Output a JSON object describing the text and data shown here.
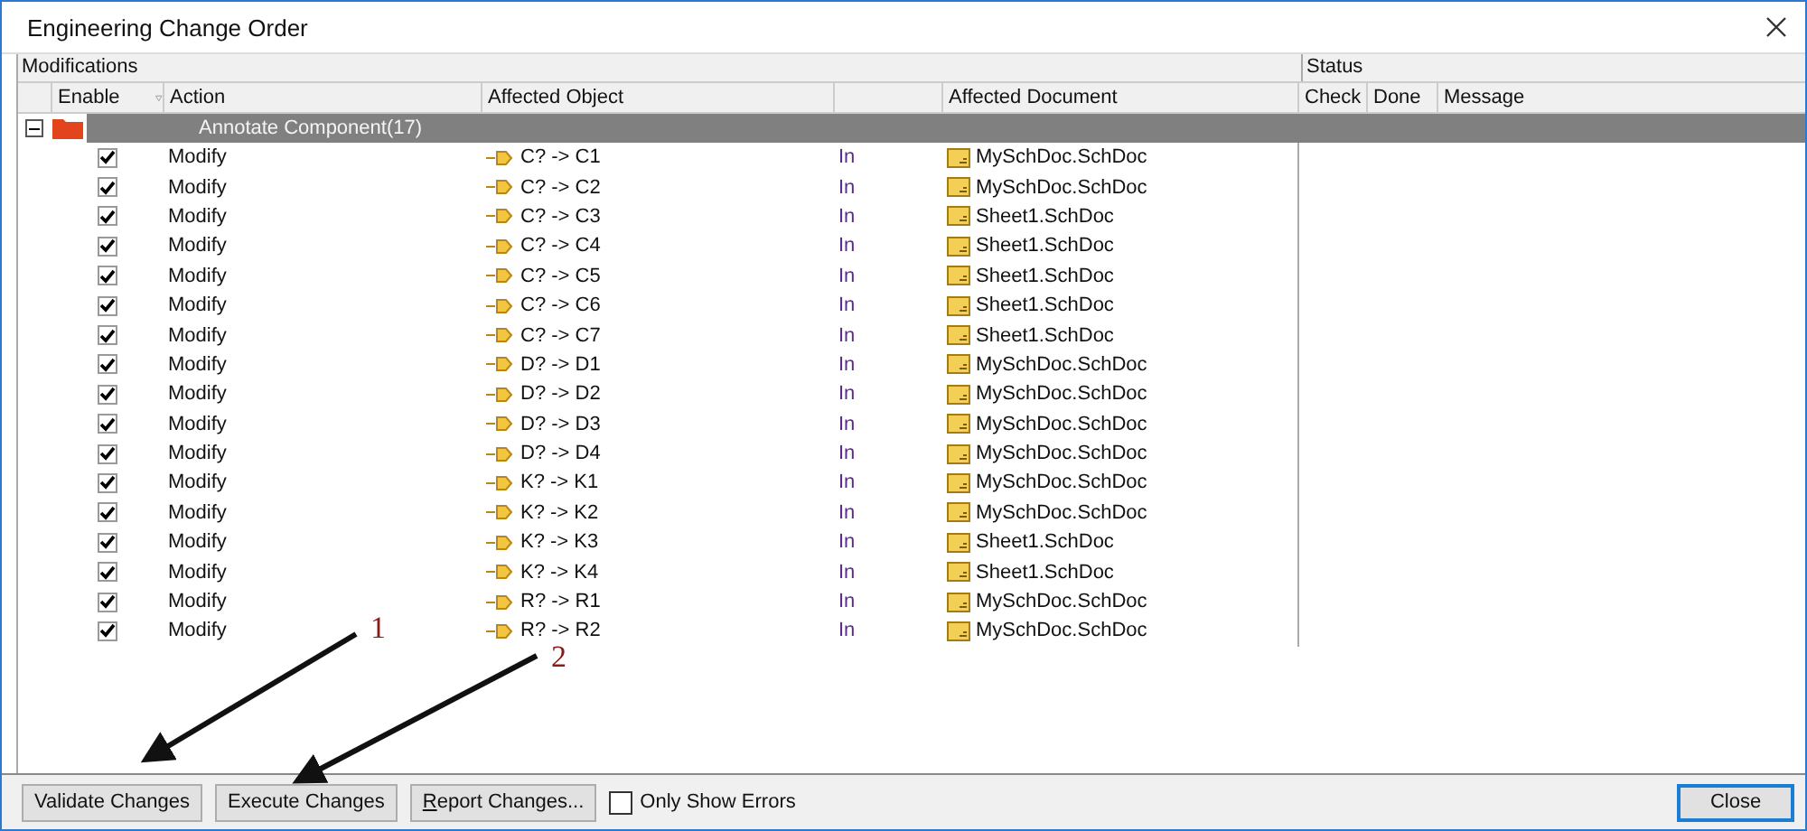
{
  "window": {
    "title": "Engineering Change Order"
  },
  "sections": {
    "modifications": "Modifications",
    "status": "Status"
  },
  "columns": {
    "enable": "Enable",
    "action": "Action",
    "affected_object": "Affected Object",
    "affected_document": "Affected Document",
    "check": "Check",
    "done": "Done",
    "message": "Message"
  },
  "group": {
    "label": "Annotate Component(17)",
    "expanded": true
  },
  "rows": [
    {
      "enabled": true,
      "action": "Modify",
      "object": "C? -> C1",
      "direction": "In",
      "document": "MySchDoc.SchDoc"
    },
    {
      "enabled": true,
      "action": "Modify",
      "object": "C? -> C2",
      "direction": "In",
      "document": "MySchDoc.SchDoc"
    },
    {
      "enabled": true,
      "action": "Modify",
      "object": "C? -> C3",
      "direction": "In",
      "document": "Sheet1.SchDoc"
    },
    {
      "enabled": true,
      "action": "Modify",
      "object": "C? -> C4",
      "direction": "In",
      "document": "Sheet1.SchDoc"
    },
    {
      "enabled": true,
      "action": "Modify",
      "object": "C? -> C5",
      "direction": "In",
      "document": "Sheet1.SchDoc"
    },
    {
      "enabled": true,
      "action": "Modify",
      "object": "C? -> C6",
      "direction": "In",
      "document": "Sheet1.SchDoc"
    },
    {
      "enabled": true,
      "action": "Modify",
      "object": "C? -> C7",
      "direction": "In",
      "document": "Sheet1.SchDoc"
    },
    {
      "enabled": true,
      "action": "Modify",
      "object": "D? -> D1",
      "direction": "In",
      "document": "MySchDoc.SchDoc"
    },
    {
      "enabled": true,
      "action": "Modify",
      "object": "D? -> D2",
      "direction": "In",
      "document": "MySchDoc.SchDoc"
    },
    {
      "enabled": true,
      "action": "Modify",
      "object": "D? -> D3",
      "direction": "In",
      "document": "MySchDoc.SchDoc"
    },
    {
      "enabled": true,
      "action": "Modify",
      "object": "D? -> D4",
      "direction": "In",
      "document": "MySchDoc.SchDoc"
    },
    {
      "enabled": true,
      "action": "Modify",
      "object": "K? -> K1",
      "direction": "In",
      "document": "MySchDoc.SchDoc"
    },
    {
      "enabled": true,
      "action": "Modify",
      "object": "K? -> K2",
      "direction": "In",
      "document": "MySchDoc.SchDoc"
    },
    {
      "enabled": true,
      "action": "Modify",
      "object": "K? -> K3",
      "direction": "In",
      "document": "Sheet1.SchDoc"
    },
    {
      "enabled": true,
      "action": "Modify",
      "object": "K? -> K4",
      "direction": "In",
      "document": "Sheet1.SchDoc"
    },
    {
      "enabled": true,
      "action": "Modify",
      "object": "R? -> R1",
      "direction": "In",
      "document": "MySchDoc.SchDoc"
    },
    {
      "enabled": true,
      "action": "Modify",
      "object": "R? -> R2",
      "direction": "In",
      "document": "MySchDoc.SchDoc"
    }
  ],
  "annotations": [
    {
      "label": "1"
    },
    {
      "label": "2"
    }
  ],
  "buttons": [
    {
      "label": "Validate Changes"
    },
    {
      "label": "Execute Changes"
    },
    {
      "segments": [
        {
          "text": "R",
          "underlined": true
        },
        {
          "text": "eport Changes...",
          "underlined": false
        }
      ]
    }
  ],
  "only_show_errors": {
    "label": "Only Show Errors",
    "checked": false
  },
  "close_button": "Close"
}
